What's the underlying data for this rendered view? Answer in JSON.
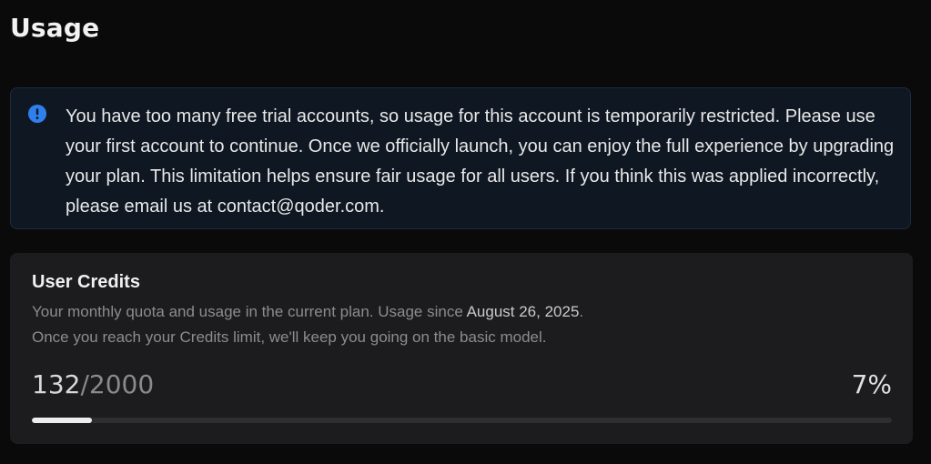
{
  "page": {
    "title": "Usage"
  },
  "alert": {
    "icon": "info-icon",
    "icon_color": "#2f80ed",
    "message": "You have too many free trial accounts, so usage for this account is temporarily restricted. Please use your first account to continue. Once we officially launch, you can enjoy the full experience by upgrading your plan. This limitation helps ensure fair usage for all users. If you think this was applied incorrectly, please email us at contact@qoder.com."
  },
  "credits": {
    "title": "User Credits",
    "desc_prefix": "Your monthly quota and usage in the current plan. Usage since ",
    "since_date": "August 26, 2025",
    "desc_suffix": ".",
    "desc_line2": "Once you reach your Credits limit, we'll keep you going on the basic model.",
    "used": "132",
    "separator": "/",
    "limit": "2000",
    "percent_label": "7%",
    "progress_fraction": 0.07
  }
}
